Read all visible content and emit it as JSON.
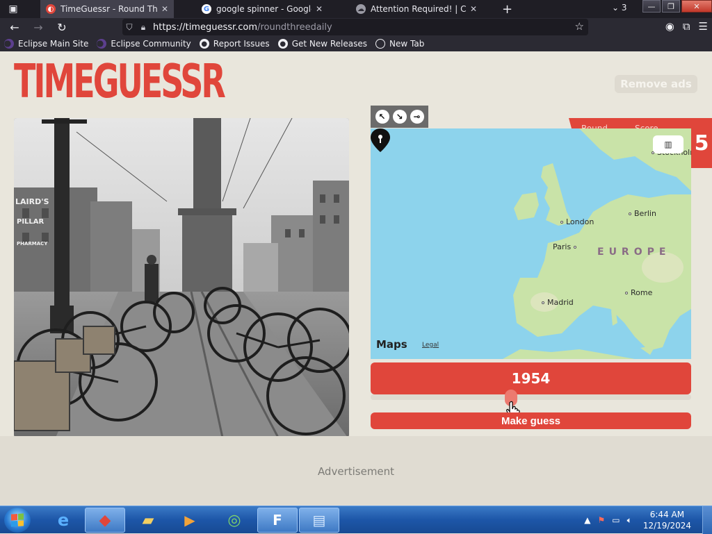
{
  "browser": {
    "tabs": [
      {
        "title": "TimeGuessr - Round Three",
        "active": true
      },
      {
        "title": "google spinner - Google Sea",
        "active": false
      },
      {
        "title": "Attention Required! | Cloudf",
        "active": false
      }
    ],
    "new_tab_symbol": "+",
    "tab_count": "3",
    "window_controls": {
      "minimize": "—",
      "restore": "❐",
      "close": "✕"
    },
    "url_host": "https://timeguessr.com",
    "url_path": "/roundthreedaily",
    "bookmarks": [
      {
        "label": "Eclipse Main Site",
        "icon": "eclipse-icon"
      },
      {
        "label": "Eclipse Community",
        "icon": "eclipse-icon"
      },
      {
        "label": "Report Issues",
        "icon": "github-icon"
      },
      {
        "label": "Get New Releases",
        "icon": "github-icon"
      },
      {
        "label": "New Tab",
        "icon": "globe-icon"
      }
    ]
  },
  "page": {
    "logo": "TIMEGUESSR",
    "remove_ads": "Remove ads",
    "round_label": "Round",
    "score_label": "Score",
    "round_number": "5",
    "map": {
      "cities": [
        {
          "name": "Stockholm"
        },
        {
          "name": "London"
        },
        {
          "name": "Berlin"
        },
        {
          "name": "Paris"
        },
        {
          "name": "Madrid"
        },
        {
          "name": "Rome"
        }
      ],
      "region_label": "EUROPE",
      "brand": "Maps",
      "legal": "Legal"
    },
    "year": "1954",
    "make_guess": "Make guess",
    "advertisement": "Advertisement",
    "photo_signs": [
      "LAIRD'S",
      "PILLAR",
      "PHARMACY"
    ]
  },
  "taskbar": {
    "time": "6:44 AM",
    "date": "12/19/2024"
  },
  "colors": {
    "accent": "#e0463b",
    "page_bg": "#e9e6dc",
    "map_water": "#8dd3ec",
    "map_land": "#c9e3a8"
  }
}
